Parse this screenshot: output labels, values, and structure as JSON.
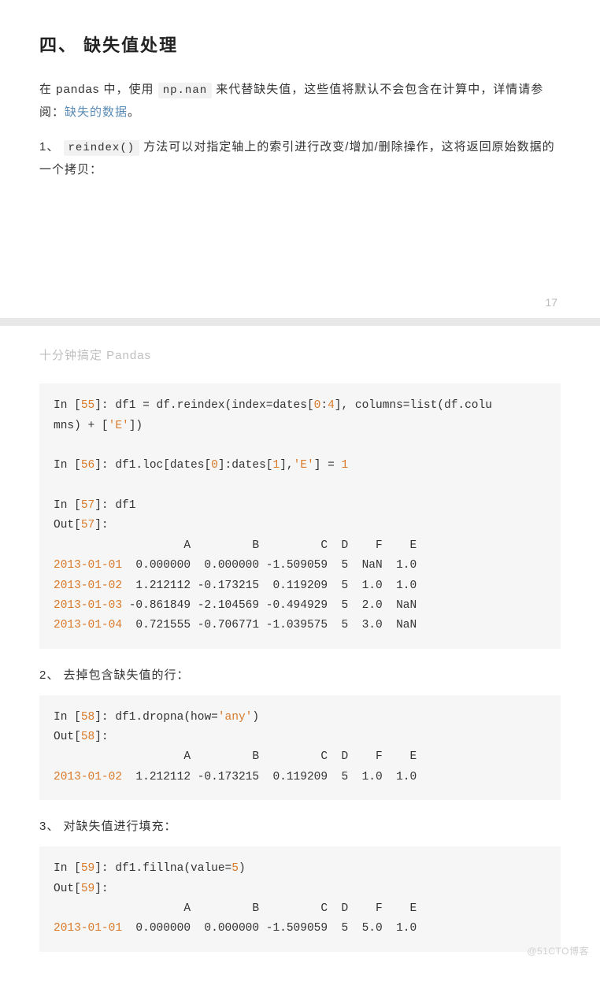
{
  "section_title": "四、 缺失值处理",
  "intro": {
    "pre": "在 pandas 中，使用 ",
    "code1": "np.nan",
    "mid": " 来代替缺失值，这些值将默认不会包含在计算中，详情请参阅：",
    "link": "缺失的数据",
    "post": "。"
  },
  "para1": {
    "num": "1、 ",
    "code": "reindex()",
    "rest": " 方法可以对指定轴上的索引进行改变/增加/删除操作，这将返回原始数据的一个拷贝："
  },
  "page_number": "17",
  "chapter_head": "十分钟搞定 Pandas",
  "code1": {
    "in55a": "In [",
    "in55n": "55",
    "in55b": "]: df1 = df.reindex(index=dates[",
    "z0": "0",
    "c1": ":",
    "z4": "4",
    "in55c": "], columns=list(df.colu",
    "in55d": "mns) + [",
    "estr": "'E'",
    "in55e": "])",
    "in56a": "In [",
    "in56n": "56",
    "in56b": "]: df1.loc[dates[",
    "in56c": "]:dates[",
    "z1": "1",
    "in56d": "],",
    "in56e": "] = ",
    "in57a": "In [",
    "in57n": "57",
    "in57b": "]: df1",
    "out57a": "Out[",
    "out57b": "]:",
    "header": "                   A         B         C  D    F    E",
    "r1d": "2013-01-01",
    "r1v": "  0.000000  0.000000 -1.509059  5  NaN  1.0",
    "r2d": "2013-01-02",
    "r2v": "  1.212112 -0.173215  0.119209  5  1.0  1.0",
    "r3d": "2013-01-03",
    "r3v": " -0.861849 -2.104569 -0.494929  5  2.0  NaN",
    "r4d": "2013-01-04",
    "r4v": "  0.721555 -0.706771 -1.039575  5  3.0  NaN"
  },
  "sub2": "2、 去掉包含缺失值的行：",
  "code2": {
    "in58a": "In [",
    "in58n": "58",
    "in58b": "]: df1.dropna(how=",
    "anystr": "'any'",
    "in58c": ")",
    "out58a": "Out[",
    "out58b": "]:",
    "header": "                   A         B         C  D    F    E",
    "r1d": "2013-01-02",
    "r1v": "  1.212112 -0.173215  0.119209  5  1.0  1.0"
  },
  "sub3": "3、 对缺失值进行填充：",
  "code3": {
    "in59a": "In [",
    "in59n": "59",
    "in59b": "]: df1.fillna(value=",
    "five": "5",
    "in59c": ")",
    "out59a": "Out[",
    "out59b": "]:",
    "header": "                   A         B         C  D    F    E",
    "r1d": "2013-01-01",
    "r1v": "  0.000000  0.000000 -1.509059  5  5.0  1.0"
  },
  "watermark": "@51CTO博客"
}
